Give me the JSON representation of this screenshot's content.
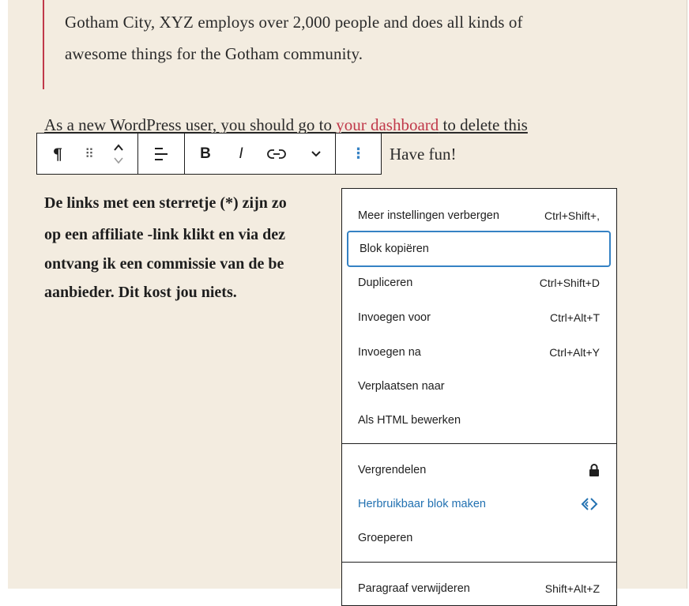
{
  "quote": {
    "line1": "Gotham City, XYZ employs over 2,000 people and does all kinds of",
    "line2": "awesome things for the Gotham community."
  },
  "paragraph": {
    "before_link": "As a new WordPress user, you should go to ",
    "link": "your dashboard",
    "after_link": " to delete this",
    "line2": "Have fun!"
  },
  "bold_paragraph": {
    "line1": "De links met een sterretje (*) zijn zo",
    "line2": "op een affiliate -link klikt en via dez",
    "line3": "ontvang ik een commissie van de be",
    "line4": "aanbieder. Dit kost jou niets."
  },
  "toolbar": {
    "paragraph_glyph": "¶",
    "drag_glyph": "⠿",
    "bold_label": "B",
    "italic_label": "I",
    "more_glyph": "⋮"
  },
  "menu": {
    "items": [
      {
        "label": "Meer instellingen verbergen",
        "shortcut": "Ctrl+Shift+,"
      },
      {
        "label": "Blok kopiëren",
        "shortcut": ""
      },
      {
        "label": "Dupliceren",
        "shortcut": "Ctrl+Shift+D"
      },
      {
        "label": "Invoegen voor",
        "shortcut": "Ctrl+Alt+T"
      },
      {
        "label": "Invoegen na",
        "shortcut": "Ctrl+Alt+Y"
      },
      {
        "label": "Verplaatsen naar",
        "shortcut": ""
      },
      {
        "label": "Als HTML bewerken",
        "shortcut": ""
      },
      {
        "label": "Vergrendelen",
        "icon": "lock-icon"
      },
      {
        "label": "Herbruikbaar blok maken",
        "icon": "reusable-block-icon"
      },
      {
        "label": "Groeperen",
        "shortcut": ""
      },
      {
        "label": "Paragraaf verwijderen",
        "shortcut": "Shift+Alt+Z"
      }
    ]
  },
  "colors": {
    "canvas_bg": "#f3ece0",
    "link": "#c0394a",
    "accent_blue": "#2271b1",
    "focus": "#3582c4"
  }
}
